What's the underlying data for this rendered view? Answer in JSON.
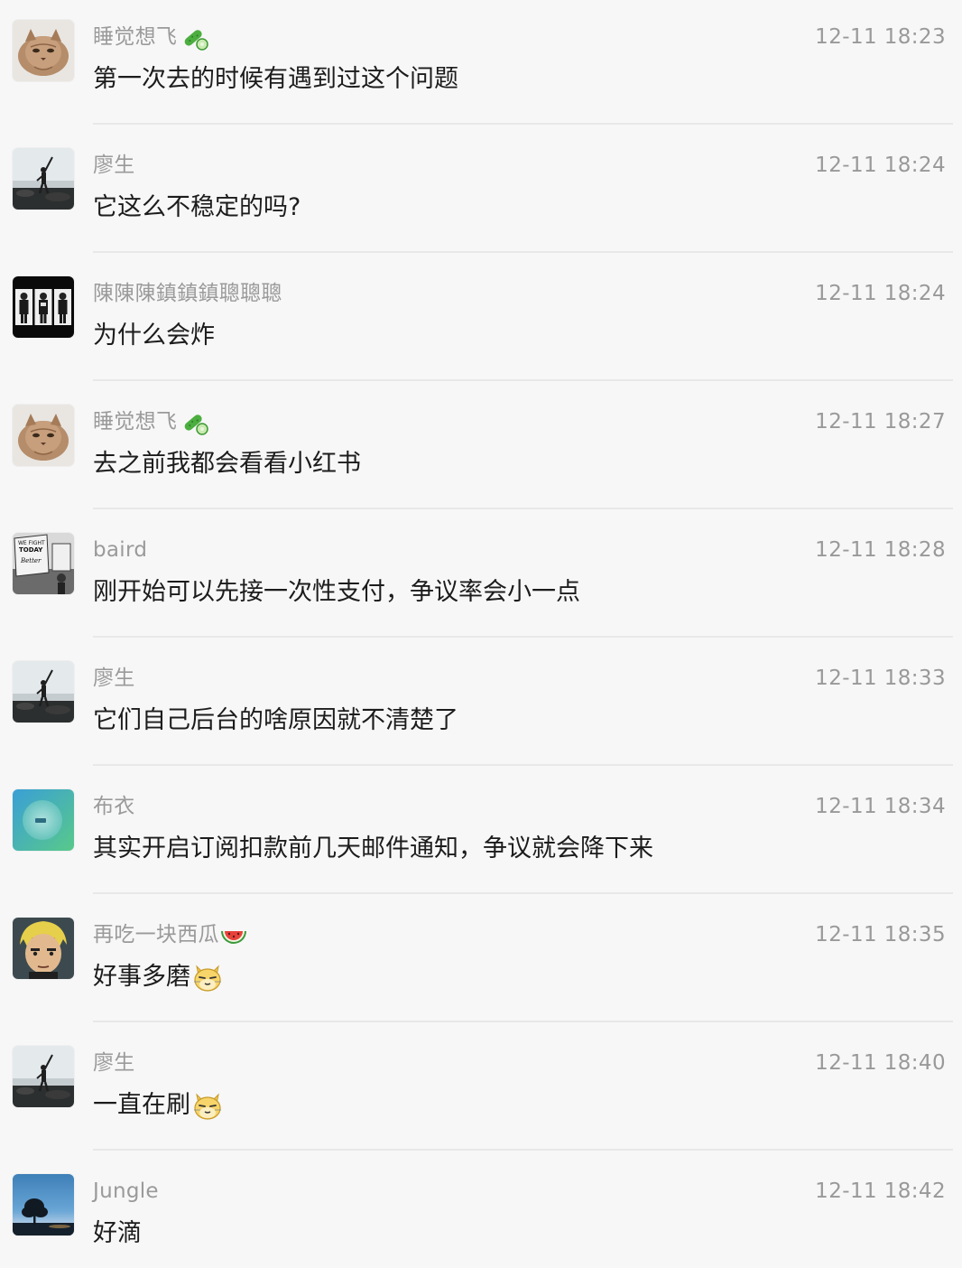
{
  "messages": [
    {
      "name": "睡觉想飞",
      "name_emoji": "cucumber-emoji",
      "time": "12-11 18:23",
      "text": "第一次去的时候有遇到过这个问题",
      "avatar": "cat-avatar"
    },
    {
      "name": "廖生",
      "time": "12-11 18:24",
      "text": "它这么不稳定的吗?",
      "avatar": "seaside-man-avatar"
    },
    {
      "name": "陳陳陳鎮鎮鎮聰聰聰",
      "time": "12-11 18:24",
      "text": "为什么会炸",
      "avatar": "three-people-avatar"
    },
    {
      "name": "睡觉想飞",
      "name_emoji": "cucumber-emoji",
      "time": "12-11 18:27",
      "text": "去之前我都会看看小红书",
      "avatar": "cat-avatar"
    },
    {
      "name": "baird",
      "time": "12-11 18:28",
      "text": "刚开始可以先接一次性支付，争议率会小一点",
      "avatar": "protest-sign-avatar"
    },
    {
      "name": "廖生",
      "time": "12-11 18:33",
      "text": "它们自己后台的啥原因就不清楚了",
      "avatar": "seaside-man-avatar"
    },
    {
      "name": "布衣",
      "time": "12-11 18:34",
      "text": "其实开启订阅扣款前几天邮件通知，争议就会降下来",
      "avatar": "gradient-circle-avatar"
    },
    {
      "name": "再吃一块西瓜",
      "name_emoji": "watermelon-emoji",
      "time": "12-11 18:35",
      "text": "好事多磨",
      "text_emoji": "cat-emoji",
      "avatar": "anime-character-avatar"
    },
    {
      "name": "廖生",
      "time": "12-11 18:40",
      "text": "一直在刷",
      "text_emoji": "cat-emoji",
      "avatar": "seaside-man-avatar"
    },
    {
      "name": "Jungle",
      "time": "12-11 18:42",
      "text": "好滴",
      "avatar": "tree-sunset-avatar"
    }
  ]
}
